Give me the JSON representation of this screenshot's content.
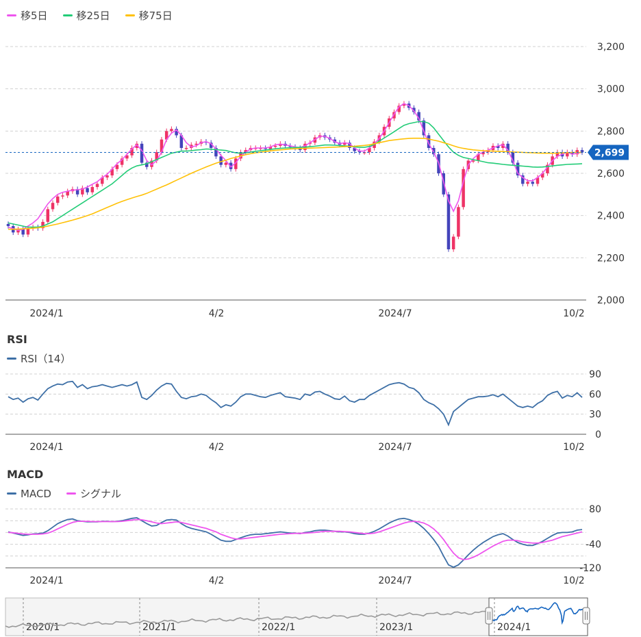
{
  "colors": {
    "up": "#ee3366",
    "down": "#4444bb",
    "ma5": "#ee55ee",
    "ma25": "#22cc77",
    "ma75": "#ffc107",
    "rsi": "#3d6fa6",
    "macd": "#3d6fa6",
    "signal": "#ee55ee",
    "current_badge": "#1565c0",
    "grid": "#d0d0d0",
    "navigator_history": "#999999",
    "navigator_range": "#1565c0"
  },
  "legend": [
    {
      "label": "移5日",
      "color": "#ee55ee"
    },
    {
      "label": "移25日",
      "color": "#22cc77"
    },
    {
      "label": "移75日",
      "color": "#ffc107"
    }
  ],
  "x_labels": [
    "2024/1",
    "4/2",
    "2024/7",
    "10/2"
  ],
  "panels": {
    "rsi": {
      "title": "RSI",
      "legend": "RSI（14）"
    },
    "macd": {
      "title": "MACD",
      "legend_macd": "MACD",
      "legend_signal": "シグナル"
    }
  },
  "current_price_label": "2,699",
  "navigator": {
    "years": [
      "2020/1",
      "2021/1",
      "2022/1",
      "2023/1",
      "2024/1"
    ]
  },
  "chart_data": [
    {
      "type": "candlestick",
      "series": [
        {
          "name": "移5日",
          "values": [
            2345,
            2338,
            2330,
            2335,
            2350,
            2365,
            2385,
            2420,
            2455,
            2480,
            2500,
            2510,
            2515,
            2520,
            2522,
            2525,
            2535,
            2548,
            2560,
            2580,
            2595,
            2620,
            2645,
            2665,
            2690,
            2715,
            2735,
            2708,
            2660,
            2640,
            2660,
            2700,
            2760,
            2790,
            2805,
            2780,
            2745,
            2725,
            2730,
            2745,
            2750,
            2740,
            2715,
            2685,
            2660,
            2630,
            2650,
            2680,
            2700,
            2715,
            2720,
            2720,
            2720,
            2725,
            2735,
            2738,
            2735,
            2730,
            2725,
            2722,
            2730,
            2745,
            2760,
            2775,
            2775,
            2765,
            2750,
            2740,
            2745,
            2740,
            2720,
            2705,
            2705,
            2720,
            2740,
            2765,
            2800,
            2840,
            2880,
            2915,
            2930,
            2920,
            2895,
            2860,
            2800,
            2740,
            2700,
            2650,
            2560,
            2470,
            2420,
            2470,
            2560,
            2640,
            2670,
            2690,
            2700,
            2710,
            2720,
            2730,
            2735,
            2710,
            2660,
            2600,
            2580,
            2565,
            2565,
            2580,
            2600,
            2630,
            2660,
            2680,
            2690,
            2700,
            2690,
            2695,
            2699
          ]
        },
        {
          "name": "移25日",
          "values": [
            2365,
            2360,
            2355,
            2350,
            2345,
            2345,
            2345,
            2350,
            2360,
            2370,
            2385,
            2400,
            2415,
            2430,
            2445,
            2460,
            2475,
            2490,
            2505,
            2520,
            2535,
            2550,
            2570,
            2590,
            2610,
            2625,
            2635,
            2640,
            2645,
            2655,
            2665,
            2675,
            2685,
            2695,
            2700,
            2705,
            2705,
            2707,
            2710,
            2712,
            2715,
            2714,
            2712,
            2710,
            2708,
            2702,
            2697,
            2695,
            2697,
            2701,
            2704,
            2707,
            2710,
            2713,
            2716,
            2718,
            2720,
            2721,
            2722,
            2723,
            2724,
            2726,
            2728,
            2731,
            2734,
            2734,
            2733,
            2731,
            2730,
            2728,
            2725,
            2723,
            2723,
            2727,
            2737,
            2752,
            2767,
            2782,
            2797,
            2812,
            2827,
            2835,
            2840,
            2845,
            2845,
            2837,
            2815,
            2785,
            2755,
            2725,
            2700,
            2685,
            2675,
            2670,
            2665,
            2660,
            2655,
            2650,
            2648,
            2645,
            2642,
            2640,
            2638,
            2636,
            2634,
            2632,
            2630,
            2629,
            2630,
            2632,
            2635,
            2638,
            2640,
            2642,
            2643,
            2644,
            2645
          ]
        },
        {
          "name": "移75日",
          "values": [
            2335,
            2335,
            2336,
            2337,
            2338,
            2340,
            2342,
            2345,
            2350,
            2355,
            2360,
            2366,
            2372,
            2378,
            2385,
            2392,
            2400,
            2408,
            2418,
            2428,
            2438,
            2448,
            2458,
            2467,
            2475,
            2483,
            2490,
            2497,
            2505,
            2515,
            2525,
            2535,
            2545,
            2556,
            2567,
            2578,
            2589,
            2600,
            2610,
            2620,
            2630,
            2639,
            2648,
            2655,
            2662,
            2670,
            2676,
            2682,
            2688,
            2693,
            2697,
            2700,
            2703,
            2706,
            2709,
            2711,
            2713,
            2715,
            2716,
            2717,
            2718,
            2719,
            2720,
            2721,
            2722,
            2723,
            2724,
            2725,
            2726,
            2727,
            2728,
            2730,
            2732,
            2735,
            2740,
            2745,
            2750,
            2755,
            2758,
            2761,
            2763,
            2765,
            2766,
            2766,
            2765,
            2762,
            2757,
            2752,
            2745,
            2738,
            2730,
            2723,
            2718,
            2714,
            2711,
            2709,
            2707,
            2706,
            2705,
            2704,
            2703,
            2702,
            2701,
            2700,
            2699,
            2698,
            2697,
            2696,
            2695,
            2695,
            2695,
            2696,
            2697,
            2698,
            2699,
            2699,
            2699
          ]
        }
      ],
      "close": [
        2350,
        2320,
        2335,
        2310,
        2340,
        2345,
        2340,
        2370,
        2430,
        2460,
        2490,
        2495,
        2515,
        2525,
        2500,
        2530,
        2510,
        2535,
        2550,
        2580,
        2590,
        2620,
        2640,
        2670,
        2685,
        2720,
        2740,
        2650,
        2630,
        2660,
        2700,
        2760,
        2800,
        2810,
        2780,
        2720,
        2720,
        2735,
        2740,
        2750,
        2745,
        2720,
        2680,
        2640,
        2650,
        2620,
        2670,
        2700,
        2710,
        2720,
        2720,
        2720,
        2715,
        2725,
        2730,
        2740,
        2730,
        2725,
        2720,
        2710,
        2740,
        2745,
        2770,
        2780,
        2770,
        2760,
        2745,
        2735,
        2745,
        2720,
        2705,
        2700,
        2700,
        2720,
        2750,
        2780,
        2820,
        2860,
        2890,
        2920,
        2930,
        2910,
        2890,
        2850,
        2780,
        2720,
        2690,
        2600,
        2500,
        2240,
        2300,
        2440,
        2620,
        2660,
        2660,
        2690,
        2700,
        2710,
        2730,
        2720,
        2740,
        2700,
        2650,
        2590,
        2550,
        2560,
        2550,
        2580,
        2600,
        2640,
        2680,
        2700,
        2680,
        2700,
        2690,
        2710,
        2699
      ]
    },
    {
      "type": "line",
      "name": "RSI（14）",
      "ylim": [
        0,
        100
      ],
      "yticks": [
        0,
        30,
        60,
        90
      ],
      "values": [
        56,
        52,
        54,
        48,
        53,
        55,
        51,
        60,
        68,
        72,
        75,
        74,
        78,
        79,
        70,
        74,
        68,
        71,
        72,
        74,
        72,
        70,
        72,
        74,
        72,
        74,
        78,
        55,
        52,
        58,
        66,
        72,
        76,
        75,
        64,
        55,
        53,
        56,
        57,
        60,
        58,
        52,
        47,
        40,
        44,
        42,
        48,
        56,
        60,
        60,
        58,
        56,
        55,
        58,
        60,
        62,
        56,
        55,
        54,
        52,
        60,
        58,
        63,
        64,
        60,
        57,
        53,
        52,
        57,
        50,
        48,
        52,
        52,
        58,
        62,
        66,
        70,
        74,
        76,
        77,
        75,
        70,
        68,
        62,
        52,
        47,
        44,
        38,
        30,
        14,
        34,
        40,
        46,
        52,
        54,
        56,
        56,
        57,
        59,
        56,
        60,
        54,
        48,
        42,
        40,
        42,
        40,
        46,
        50,
        58,
        62,
        64,
        54,
        58,
        56,
        62,
        55
      ]
    },
    {
      "type": "line",
      "ylim": [
        -130,
        110
      ],
      "yticks": [
        -120,
        -40,
        80
      ],
      "series": [
        {
          "name": "MACD",
          "values": [
            2,
            -2,
            -6,
            -10,
            -8,
            -5,
            -4,
            -2,
            6,
            18,
            30,
            38,
            44,
            46,
            40,
            38,
            36,
            36,
            36,
            38,
            38,
            37,
            38,
            40,
            44,
            48,
            50,
            40,
            30,
            22,
            24,
            34,
            42,
            44,
            42,
            30,
            20,
            14,
            10,
            6,
            2,
            -6,
            -16,
            -26,
            -30,
            -30,
            -24,
            -18,
            -12,
            -8,
            -6,
            -6,
            -4,
            -2,
            0,
            2,
            0,
            -2,
            -2,
            -4,
            0,
            2,
            6,
            8,
            8,
            6,
            4,
            2,
            2,
            0,
            -4,
            -6,
            -6,
            -2,
            4,
            12,
            22,
            32,
            40,
            46,
            48,
            44,
            38,
            28,
            14,
            -4,
            -24,
            -48,
            -80,
            -110,
            -118,
            -110,
            -94,
            -76,
            -60,
            -46,
            -34,
            -24,
            -14,
            -8,
            -4,
            -12,
            -24,
            -34,
            -40,
            -44,
            -44,
            -38,
            -30,
            -20,
            -10,
            -2,
            0,
            0,
            2,
            8,
            10
          ]
        },
        {
          "name": "シグナル",
          "values": [
            0,
            -1,
            -3,
            -5,
            -6,
            -6,
            -6,
            -5,
            -2,
            4,
            12,
            20,
            28,
            34,
            38,
            38,
            38,
            37,
            37,
            37,
            37,
            37,
            37,
            38,
            40,
            42,
            44,
            43,
            40,
            36,
            32,
            30,
            32,
            34,
            36,
            34,
            30,
            26,
            22,
            18,
            14,
            8,
            2,
            -6,
            -12,
            -18,
            -22,
            -22,
            -20,
            -18,
            -16,
            -14,
            -12,
            -10,
            -8,
            -6,
            -5,
            -4,
            -3,
            -3,
            -2,
            -1,
            0,
            2,
            4,
            4,
            4,
            4,
            3,
            2,
            0,
            -2,
            -4,
            -4,
            -2,
            2,
            8,
            14,
            20,
            26,
            32,
            36,
            38,
            36,
            32,
            24,
            12,
            -4,
            -24,
            -48,
            -70,
            -86,
            -92,
            -90,
            -84,
            -76,
            -66,
            -56,
            -46,
            -38,
            -30,
            -26,
            -26,
            -28,
            -32,
            -34,
            -36,
            -36,
            -34,
            -30,
            -26,
            -20,
            -14,
            -10,
            -6,
            -2,
            2
          ]
        }
      ]
    }
  ]
}
